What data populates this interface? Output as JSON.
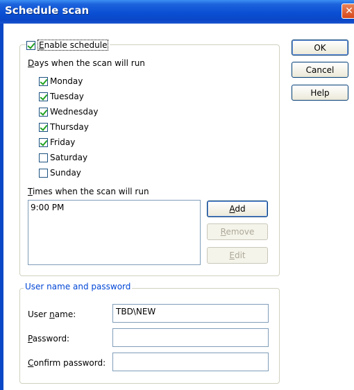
{
  "title": "Schedule scan",
  "close_glyph": "✕",
  "buttons": {
    "ok": "OK",
    "cancel": "Cancel",
    "help": "Help"
  },
  "schedule": {
    "enable_label": "Enable schedule",
    "enabled": true,
    "days_label": "Days when the scan will run",
    "days": [
      {
        "label": "Monday",
        "checked": true
      },
      {
        "label": "Tuesday",
        "checked": true
      },
      {
        "label": "Wednesday",
        "checked": true
      },
      {
        "label": "Thursday",
        "checked": true
      },
      {
        "label": "Friday",
        "checked": true
      },
      {
        "label": "Saturday",
        "checked": false
      },
      {
        "label": "Sunday",
        "checked": false
      }
    ],
    "times_label": "Times when the scan will run",
    "times": [
      "9:00 PM"
    ],
    "add": "Add",
    "remove": "Remove",
    "edit": "Edit"
  },
  "credentials": {
    "legend": "User name and password",
    "username_label": "User name:",
    "username_value": "TBD\\NEW",
    "password_label": "Password:",
    "password_value": "",
    "confirm_label": "Confirm password:",
    "confirm_value": ""
  },
  "colors": {
    "title_bar": "#0a47c7",
    "legend_blue": "#0046d5",
    "check_green": "#21a121"
  }
}
